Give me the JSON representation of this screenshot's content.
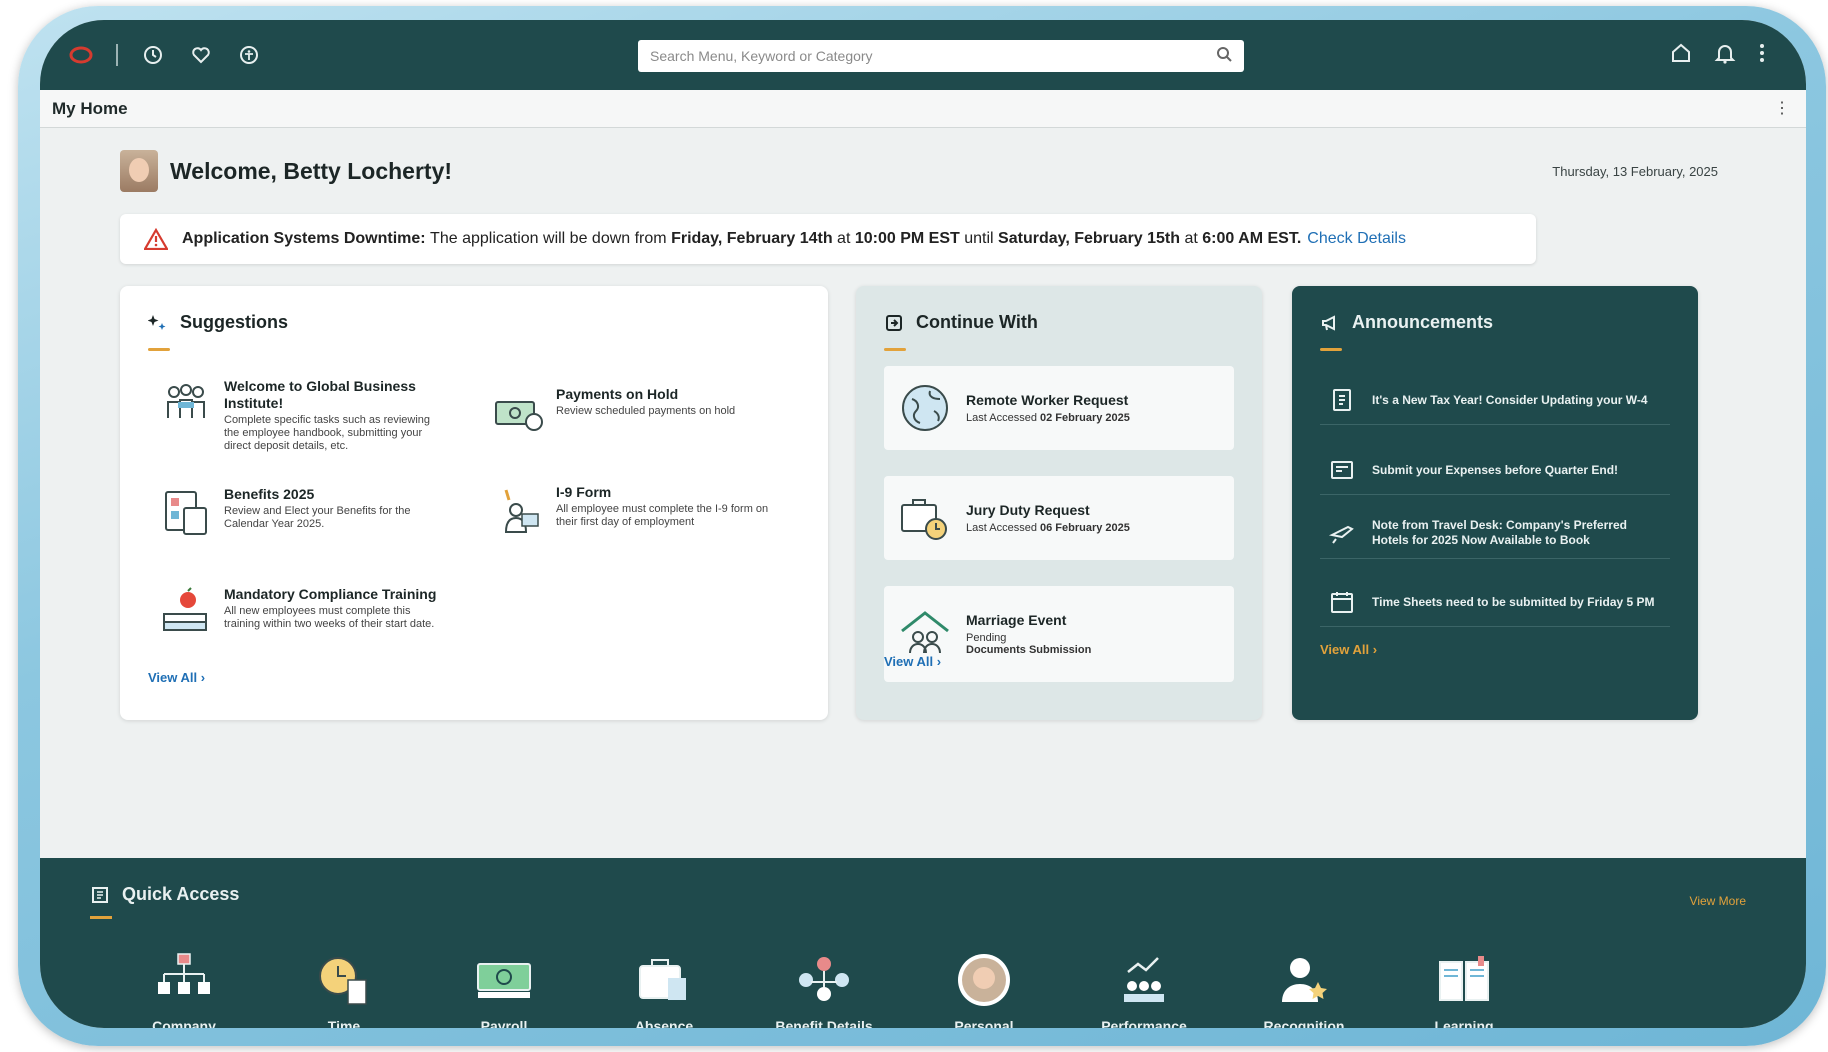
{
  "topbar": {
    "search_placeholder": "Search Menu, Keyword or Category"
  },
  "page": {
    "title": "My Home"
  },
  "welcome": {
    "text": "Welcome, Betty Locherty!",
    "date": "Thursday, 13 February, 2025"
  },
  "alert": {
    "label": "Application Systems Downtime:",
    "text1": "The application will be down from",
    "start": "Friday, February 14th",
    "at1": "at",
    "start_time": "10:00 PM EST",
    "until": "until",
    "end": "Saturday, February 15th",
    "at2": "at",
    "end_time": "6:00 AM EST.",
    "link": "Check Details"
  },
  "suggestions": {
    "title": "Suggestions",
    "items": [
      {
        "title": "Welcome to Global Business Institute!",
        "desc": "Complete specific tasks such as reviewing the employee handbook, submitting your direct deposit details, etc."
      },
      {
        "title": "Payments on Hold",
        "desc": "Review scheduled payments on hold"
      },
      {
        "title": "Benefits 2025",
        "desc": "Review and Elect your Benefits for the Calendar Year 2025."
      },
      {
        "title": "I-9 Form",
        "desc": "All employee must complete the I-9 form on their first day of employment"
      },
      {
        "title": "Mandatory Compliance Training",
        "desc": "All new employees must complete this training within two weeks of their start date."
      }
    ],
    "view_all": "View All"
  },
  "continue": {
    "title": "Continue With",
    "items": [
      {
        "title": "Remote Worker Request",
        "sub_prefix": "Last Accessed",
        "sub_date": "02 February 2025"
      },
      {
        "title": "Jury Duty Request",
        "sub_prefix": "Last Accessed",
        "sub_date": "06 February 2025"
      },
      {
        "title": "Marriage Event",
        "sub_prefix": "Pending",
        "sub_date": "Documents Submission"
      }
    ],
    "view_all": "View All"
  },
  "announcements": {
    "title": "Announcements",
    "items": [
      {
        "text": "It's a New Tax Year! Consider Updating your W-4",
        "icon": "tax-form-icon"
      },
      {
        "text": "Submit your Expenses before Quarter End!",
        "icon": "expense-icon"
      },
      {
        "text": "Note from Travel Desk: Company's Preferred Hotels for 2025 Now Available to Book",
        "icon": "travel-icon"
      },
      {
        "text": "Time Sheets need to be submitted by Friday 5 PM",
        "icon": "timesheet-icon"
      }
    ],
    "view_all": "View All"
  },
  "quick_access": {
    "title": "Quick Access",
    "view_more": "View More",
    "items": [
      {
        "label": "Company"
      },
      {
        "label": "Time"
      },
      {
        "label": "Payroll"
      },
      {
        "label": "Absence"
      },
      {
        "label": "Benefit Details"
      },
      {
        "label": "Personal"
      },
      {
        "label": "Performance"
      },
      {
        "label": "Recognition"
      },
      {
        "label": "Learning"
      }
    ]
  },
  "colors": {
    "dark_teal": "#1f4a4c",
    "accent": "#e2a23b",
    "link": "#1f6fb5"
  }
}
